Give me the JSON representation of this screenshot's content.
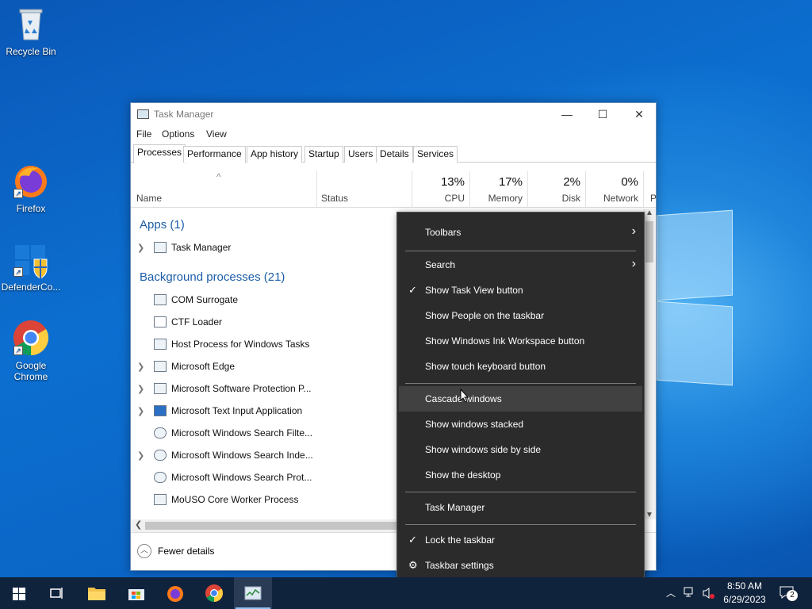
{
  "desktop": {
    "icons": [
      {
        "label": "Recycle Bin"
      },
      {
        "label": "Firefox"
      },
      {
        "label": "DefenderCo..."
      },
      {
        "label": "Google Chrome"
      }
    ]
  },
  "task_manager": {
    "title": "Task Manager",
    "menu": [
      "File",
      "Options",
      "View"
    ],
    "tabs": [
      "Processes",
      "Performance",
      "App history",
      "Startup",
      "Users",
      "Details",
      "Services"
    ],
    "columns": {
      "name": "Name",
      "status": "Status",
      "cpu_pct": "13%",
      "cpu": "CPU",
      "memory_pct": "17%",
      "memory": "Memory",
      "disk_pct": "2%",
      "disk": "Disk",
      "network_pct": "0%",
      "network": "Network",
      "cut": "P"
    },
    "apps_header": "Apps (1)",
    "background_header": "Background processes (21)",
    "apps": [
      {
        "name": "Task Manager",
        "expandable": true
      }
    ],
    "processes": [
      {
        "name": "COM Surrogate",
        "expandable": false
      },
      {
        "name": "CTF Loader",
        "expandable": false
      },
      {
        "name": "Host Process for Windows Tasks",
        "expandable": false
      },
      {
        "name": "Microsoft Edge",
        "expandable": true
      },
      {
        "name": "Microsoft Software Protection P...",
        "expandable": true
      },
      {
        "name": "Microsoft Text Input Application",
        "expandable": true
      },
      {
        "name": "Microsoft Windows Search Filte...",
        "expandable": false
      },
      {
        "name": "Microsoft Windows Search Inde...",
        "expandable": true
      },
      {
        "name": "Microsoft Windows Search Prot...",
        "expandable": false
      },
      {
        "name": "MoUSO Core Worker Process",
        "expandable": false
      }
    ],
    "fewer_details": "Fewer details"
  },
  "context_menu": {
    "items": [
      {
        "label": "Toolbars",
        "submenu": true
      },
      {
        "label": "Search",
        "submenu": true
      },
      {
        "label": "Show Task View button",
        "checked": true
      },
      {
        "label": "Show People on the taskbar"
      },
      {
        "label": "Show Windows Ink Workspace button"
      },
      {
        "label": "Show touch keyboard button"
      },
      {
        "label": "Cascade windows",
        "highlighted": true
      },
      {
        "label": "Show windows stacked"
      },
      {
        "label": "Show windows side by side"
      },
      {
        "label": "Show the desktop"
      },
      {
        "label": "Task Manager"
      },
      {
        "label": "Lock the taskbar",
        "checked": true
      },
      {
        "label": "Taskbar settings",
        "icon": "gear-icon"
      }
    ]
  },
  "taskbar": {
    "time": "8:50 AM",
    "date": "6/29/2023",
    "notification_count": "2",
    "apps": [
      "start",
      "task-view",
      "file-explorer",
      "microsoft-store",
      "firefox",
      "chrome",
      "task-manager"
    ]
  }
}
